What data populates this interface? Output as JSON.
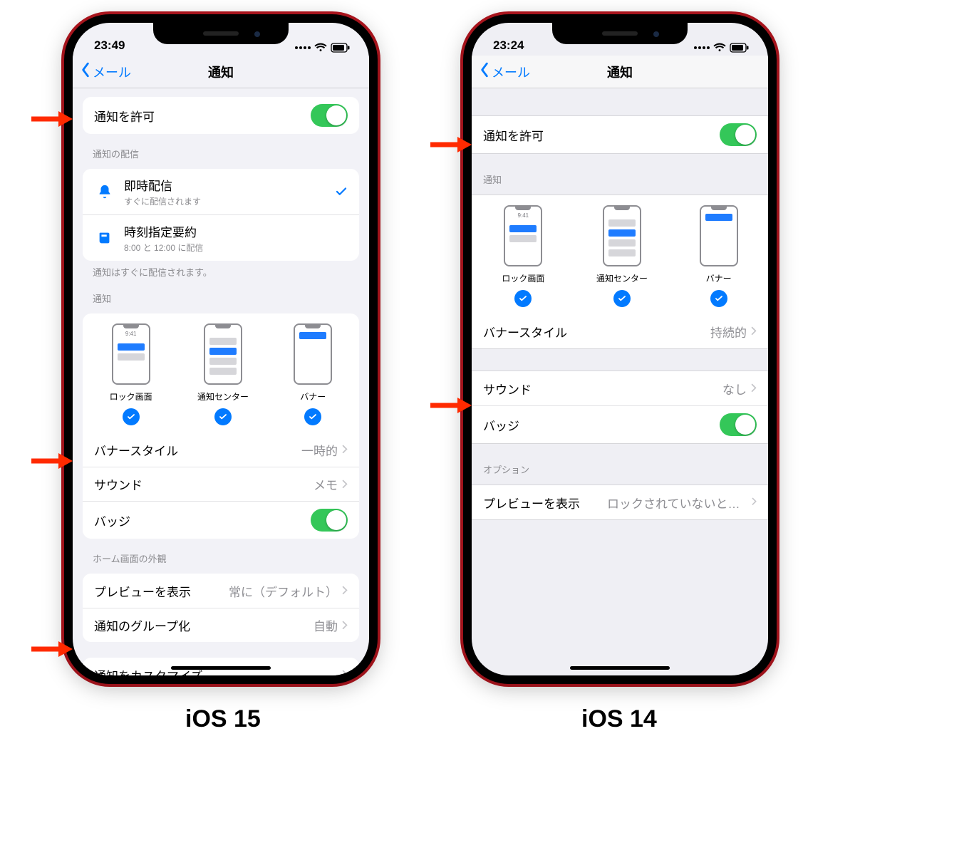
{
  "captions": {
    "ios15": "iOS 15",
    "ios14": "iOS 14"
  },
  "ios15": {
    "status_time": "23:49",
    "nav_back": "メール",
    "nav_title": "通知",
    "allow_label": "通知を許可",
    "delivery_header": "通知の配信",
    "delivery": [
      {
        "title": "即時配信",
        "subtitle": "すぐに配信されます",
        "icon": "bell",
        "checked": true
      },
      {
        "title": "時刻指定要約",
        "subtitle": "8:00 と 12:00 に配信",
        "icon": "newspaper",
        "checked": false
      }
    ],
    "delivery_footer": "通知はすぐに配信されます。",
    "styles_header": "通知",
    "styles": {
      "lock_time": "9:41",
      "labels": {
        "lock": "ロック画面",
        "center": "通知センター",
        "banner": "バナー"
      }
    },
    "banner_style_label": "バナースタイル",
    "banner_style_value": "一時的",
    "sound_label": "サウンド",
    "sound_value": "メモ",
    "badge_label": "バッジ",
    "appearance_header": "ホーム画面の外観",
    "preview_label": "プレビューを表示",
    "preview_value": "常に（デフォルト）",
    "grouping_label": "通知のグループ化",
    "grouping_value": "自動",
    "customize_label": "通知をカスタマイズ"
  },
  "ios14": {
    "status_time": "23:24",
    "nav_back": "メール",
    "nav_title": "通知",
    "allow_label": "通知を許可",
    "styles_header": "通知",
    "styles": {
      "lock_time": "9:41",
      "labels": {
        "lock": "ロック画面",
        "center": "通知センター",
        "banner": "バナー"
      }
    },
    "banner_style_label": "バナースタイル",
    "banner_style_value": "持続的",
    "sound_label": "サウンド",
    "sound_value": "なし",
    "badge_label": "バッジ",
    "options_header": "オプション",
    "preview_label": "プレビューを表示",
    "preview_value": "ロックされていないときの…"
  }
}
